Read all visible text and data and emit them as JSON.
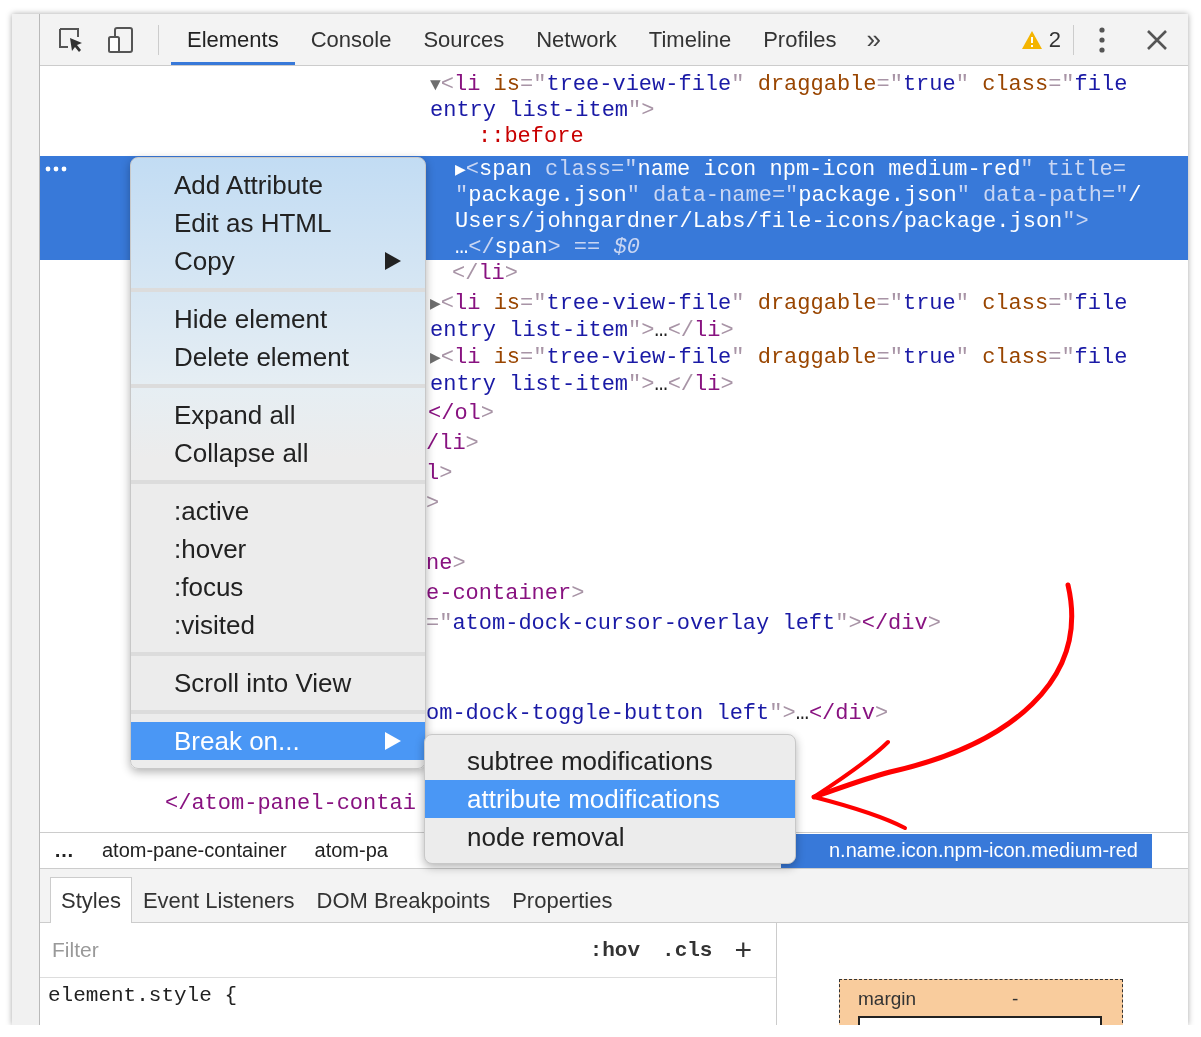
{
  "toolbar": {
    "tabs": [
      {
        "label": "Elements",
        "selected": true
      },
      {
        "label": "Console",
        "selected": false
      },
      {
        "label": "Sources",
        "selected": false
      },
      {
        "label": "Network",
        "selected": false
      },
      {
        "label": "Timeline",
        "selected": false
      },
      {
        "label": "Profiles",
        "selected": false
      }
    ],
    "overflow": "»",
    "warnings": "2"
  },
  "code": [
    {
      "selected": false,
      "lines": [
        [
          {
            "kind": "arrow",
            "text": "▼"
          },
          {
            "kind": "punct",
            "text": "<"
          },
          {
            "kind": "tag",
            "text": "li"
          },
          {
            "kind": "attr",
            "text": " is"
          },
          {
            "kind": "punct",
            "text": "=\""
          },
          {
            "kind": "value",
            "text": "tree-view-file"
          },
          {
            "kind": "punct",
            "text": "\""
          },
          {
            "kind": "attr",
            "text": " draggable"
          },
          {
            "kind": "punct",
            "text": "=\""
          },
          {
            "kind": "value",
            "text": "true"
          },
          {
            "kind": "punct",
            "text": "\""
          },
          {
            "kind": "attr",
            "text": " class"
          },
          {
            "kind": "punct",
            "text": "=\""
          },
          {
            "kind": "value",
            "text": "file"
          }
        ],
        [
          {
            "kind": "value",
            "text": "entry list-item"
          },
          {
            "kind": "punct",
            "text": "\">"
          }
        ]
      ]
    },
    {
      "selected": false,
      "lines": [
        [
          {
            "kind": "pseudo",
            "text": "::before"
          }
        ]
      ]
    },
    {
      "selected": true,
      "lines": [
        [
          {
            "kind": "arrow",
            "text": "▶"
          },
          {
            "kind": "punct",
            "text": "<"
          },
          {
            "kind": "tag",
            "text": "span"
          },
          {
            "kind": "attr",
            "text": " class"
          },
          {
            "kind": "punct",
            "text": "=\""
          },
          {
            "kind": "value",
            "text": "name icon npm-icon medium-red"
          },
          {
            "kind": "punct",
            "text": "\""
          },
          {
            "kind": "attr",
            "text": " title"
          },
          {
            "kind": "punct",
            "text": "="
          }
        ],
        [
          {
            "kind": "punct",
            "text": "\""
          },
          {
            "kind": "value",
            "text": "package.json"
          },
          {
            "kind": "punct",
            "text": "\""
          },
          {
            "kind": "attr",
            "text": " data-name"
          },
          {
            "kind": "punct",
            "text": "=\""
          },
          {
            "kind": "value",
            "text": "package.json"
          },
          {
            "kind": "punct",
            "text": "\""
          },
          {
            "kind": "attr",
            "text": " data-path"
          },
          {
            "kind": "punct",
            "text": "=\""
          },
          {
            "kind": "value",
            "text": "/"
          }
        ],
        [
          {
            "kind": "value",
            "text": "Users/johngardner/Labs/file-icons/package.json"
          },
          {
            "kind": "punct",
            "text": "\">"
          }
        ],
        [
          {
            "kind": "plain",
            "text": "…"
          },
          {
            "kind": "punct",
            "text": "</"
          },
          {
            "kind": "tag",
            "text": "span"
          },
          {
            "kind": "punct",
            "text": "> == "
          },
          {
            "kind": "ref",
            "text": "$0"
          }
        ]
      ]
    },
    {
      "selected": false,
      "lines": [
        [
          {
            "kind": "punct",
            "text": "</"
          },
          {
            "kind": "tag",
            "text": "li"
          },
          {
            "kind": "punct",
            "text": ">"
          }
        ]
      ]
    },
    {
      "selected": false,
      "lines": [
        [
          {
            "kind": "arrow",
            "text": "▶"
          },
          {
            "kind": "punct",
            "text": "<"
          },
          {
            "kind": "tag",
            "text": "li"
          },
          {
            "kind": "attr",
            "text": " is"
          },
          {
            "kind": "punct",
            "text": "=\""
          },
          {
            "kind": "value",
            "text": "tree-view-file"
          },
          {
            "kind": "punct",
            "text": "\""
          },
          {
            "kind": "attr",
            "text": " draggable"
          },
          {
            "kind": "punct",
            "text": "=\""
          },
          {
            "kind": "value",
            "text": "true"
          },
          {
            "kind": "punct",
            "text": "\""
          },
          {
            "kind": "attr",
            "text": " class"
          },
          {
            "kind": "punct",
            "text": "=\""
          },
          {
            "kind": "value",
            "text": "file"
          }
        ],
        [
          {
            "kind": "value",
            "text": "entry list-item"
          },
          {
            "kind": "punct",
            "text": "\">"
          },
          {
            "kind": "plain",
            "text": "…"
          },
          {
            "kind": "punct",
            "text": "</"
          },
          {
            "kind": "tag",
            "text": "li"
          },
          {
            "kind": "punct",
            "text": ">"
          }
        ]
      ]
    },
    {
      "selected": false,
      "lines": [
        [
          {
            "kind": "arrow",
            "text": "▶"
          },
          {
            "kind": "punct",
            "text": "<"
          },
          {
            "kind": "tag",
            "text": "li"
          },
          {
            "kind": "attr",
            "text": " is"
          },
          {
            "kind": "punct",
            "text": "=\""
          },
          {
            "kind": "value",
            "text": "tree-view-file"
          },
          {
            "kind": "punct",
            "text": "\""
          },
          {
            "kind": "attr",
            "text": " draggable"
          },
          {
            "kind": "punct",
            "text": "=\""
          },
          {
            "kind": "value",
            "text": "true"
          },
          {
            "kind": "punct",
            "text": "\""
          },
          {
            "kind": "attr",
            "text": " class"
          },
          {
            "kind": "punct",
            "text": "=\""
          },
          {
            "kind": "value",
            "text": "file"
          }
        ],
        [
          {
            "kind": "value",
            "text": "entry list-item"
          },
          {
            "kind": "punct",
            "text": "\">"
          },
          {
            "kind": "plain",
            "text": "…"
          },
          {
            "kind": "punct",
            "text": "</"
          },
          {
            "kind": "tag",
            "text": "li"
          },
          {
            "kind": "punct",
            "text": ">"
          }
        ]
      ]
    },
    {
      "selected": false,
      "lines": [
        [
          {
            "kind": "tag",
            "text": "</ol"
          },
          {
            "kind": "punct",
            "text": ">"
          }
        ]
      ]
    },
    {
      "selected": false,
      "lines": [
        [
          {
            "kind": "tag",
            "text": "/li"
          },
          {
            "kind": "punct",
            "text": ">"
          }
        ]
      ]
    },
    {
      "selected": false,
      "lines": [
        [
          {
            "kind": "tag",
            "text": "l"
          },
          {
            "kind": "punct",
            "text": ">"
          }
        ]
      ]
    },
    {
      "selected": false,
      "lines": [
        [
          {
            "kind": "punct",
            "text": ">"
          }
        ]
      ]
    },
    {
      "selected": false,
      "lines": [
        [
          {
            "kind": "tag",
            "text": "ne"
          },
          {
            "kind": "punct",
            "text": ">"
          }
        ]
      ]
    },
    {
      "selected": false,
      "lines": [
        [
          {
            "kind": "tag",
            "text": "e-container"
          },
          {
            "kind": "punct",
            "text": ">"
          }
        ]
      ]
    },
    {
      "selected": false,
      "lines": [
        [
          {
            "kind": "punct",
            "text": "=\""
          },
          {
            "kind": "value",
            "text": "atom-dock-cursor-overlay left"
          },
          {
            "kind": "punct",
            "text": "\">"
          },
          {
            "kind": "tag",
            "text": "</div"
          },
          {
            "kind": "punct",
            "text": ">"
          }
        ]
      ]
    },
    {
      "selected": false,
      "lines": [
        [
          {
            "kind": "value",
            "text": "om-dock-toggle-button left"
          },
          {
            "kind": "punct",
            "text": "\">"
          },
          {
            "kind": "plain",
            "text": "…"
          },
          {
            "kind": "tag",
            "text": "</div"
          },
          {
            "kind": "punct",
            "text": ">"
          }
        ]
      ]
    },
    {
      "selected": false,
      "lines": [
        [
          {
            "kind": "tag",
            "text": "</atom-panel-contai"
          }
        ]
      ]
    }
  ],
  "context_menu": {
    "groups": [
      [
        {
          "label": "Add Attribute",
          "has_submenu": false,
          "selected": false
        },
        {
          "label": "Edit as HTML",
          "has_submenu": false,
          "selected": false
        },
        {
          "label": "Copy",
          "has_submenu": true,
          "selected": false
        }
      ],
      [
        {
          "label": "Hide element",
          "has_submenu": false,
          "selected": false
        },
        {
          "label": "Delete element",
          "has_submenu": false,
          "selected": false
        }
      ],
      [
        {
          "label": "Expand all",
          "has_submenu": false,
          "selected": false
        },
        {
          "label": "Collapse all",
          "has_submenu": false,
          "selected": false
        }
      ],
      [
        {
          "label": ":active",
          "has_submenu": false,
          "selected": false
        },
        {
          "label": ":hover",
          "has_submenu": false,
          "selected": false
        },
        {
          "label": ":focus",
          "has_submenu": false,
          "selected": false
        },
        {
          "label": ":visited",
          "has_submenu": false,
          "selected": false
        }
      ],
      [
        {
          "label": "Scroll into View",
          "has_submenu": false,
          "selected": false
        }
      ],
      [
        {
          "label": "Break on...",
          "has_submenu": true,
          "selected": true
        }
      ]
    ]
  },
  "submenu": [
    {
      "label": "subtree modifications",
      "selected": false
    },
    {
      "label": "attribute modifications",
      "selected": true
    },
    {
      "label": "node removal",
      "selected": false
    }
  ],
  "breadcrumb_overflow": "…",
  "breadcrumbs": [
    {
      "label": "atom-pane-container",
      "selected": false
    },
    {
      "label": "atom-pa",
      "selected": false
    },
    {
      "label": "n.name.icon.npm-icon.medium-red",
      "selected": true
    }
  ],
  "styles_pane": {
    "tabs": [
      {
        "label": "Styles",
        "selected": true
      },
      {
        "label": "Event Listeners",
        "selected": false
      },
      {
        "label": "DOM Breakpoints",
        "selected": false
      },
      {
        "label": "Properties",
        "selected": false
      }
    ],
    "filter": {
      "placeholder": "Filter"
    },
    "hov": ":hov",
    "cls": ".cls",
    "add": "+",
    "rule": "element.style {"
  },
  "box_model": {
    "label": "margin",
    "value": "-"
  }
}
